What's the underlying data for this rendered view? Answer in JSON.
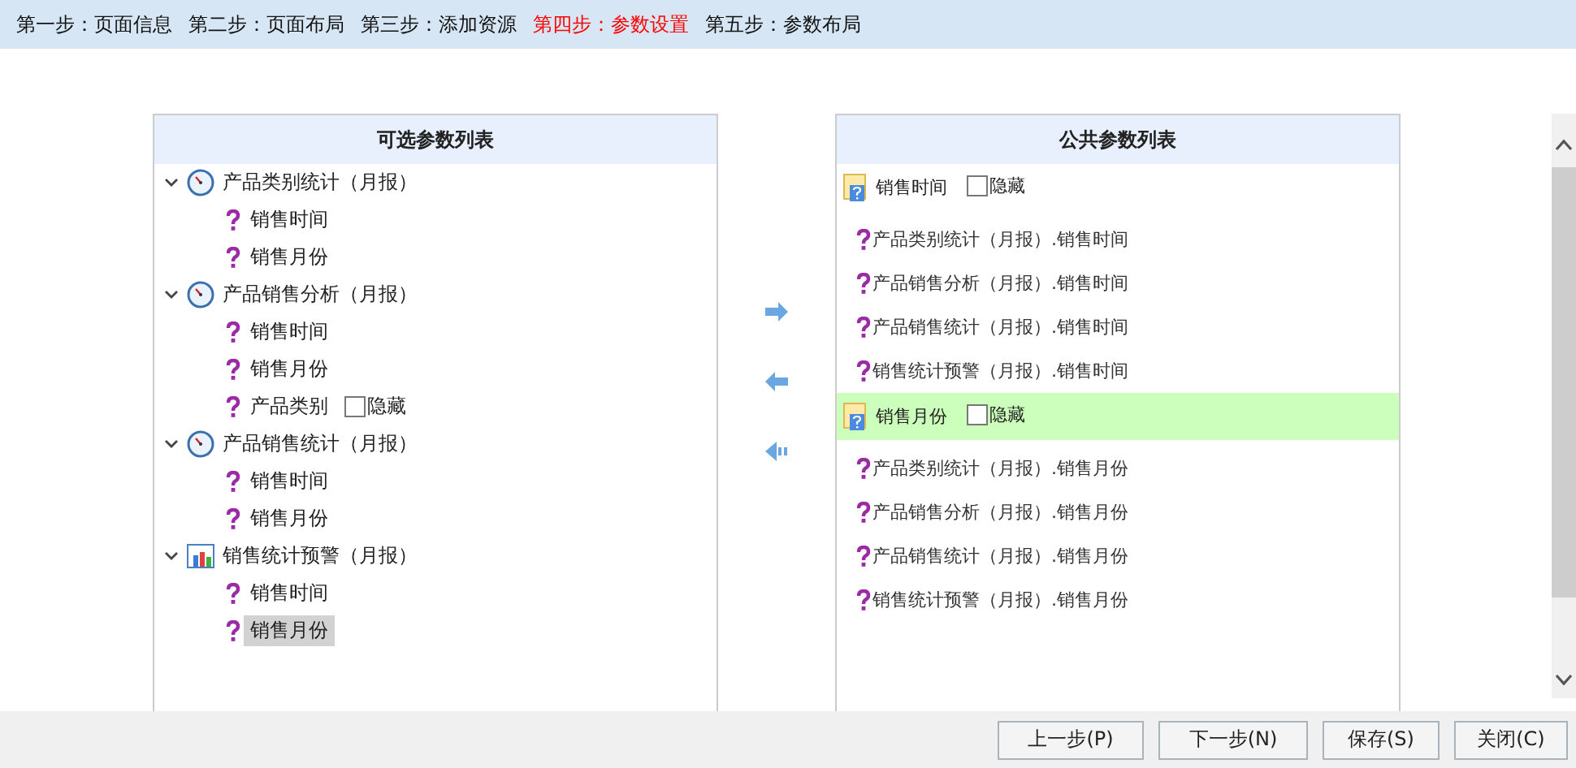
{
  "steps": [
    {
      "label": "第一步：页面信息",
      "selected": false
    },
    {
      "label": "第二步：页面布局",
      "selected": false
    },
    {
      "label": "第三步：添加资源",
      "selected": false
    },
    {
      "label": "第四步：参数设置",
      "selected": true
    },
    {
      "label": "第五步：参数布局",
      "selected": false
    }
  ],
  "available_panel": {
    "title": "可选参数列表",
    "groups": [
      {
        "label": "产品类别统计（月报）",
        "kind": "clock",
        "expanded": true,
        "children": [
          {
            "label": "销售时间",
            "selected": false
          },
          {
            "label": "销售月份",
            "selected": false
          }
        ]
      },
      {
        "label": "产品销售分析（月报）",
        "kind": "clock",
        "expanded": true,
        "children": [
          {
            "label": "销售时间",
            "selected": false
          },
          {
            "label": "销售月份",
            "selected": false
          },
          {
            "label": "产品类别",
            "selected": false,
            "hide_option": {
              "label": "隐藏",
              "checked": false
            }
          }
        ]
      },
      {
        "label": "产品销售统计（月报）",
        "kind": "clock",
        "expanded": true,
        "children": [
          {
            "label": "销售时间",
            "selected": false
          },
          {
            "label": "销售月份",
            "selected": false
          }
        ]
      },
      {
        "label": "销售统计预警（月报）",
        "kind": "chart",
        "expanded": true,
        "children": [
          {
            "label": "销售时间",
            "selected": false
          },
          {
            "label": "销售月份",
            "selected": true
          }
        ]
      }
    ]
  },
  "public_panel": {
    "title": "公共参数列表",
    "params": [
      {
        "label": "销售时间",
        "selected": false,
        "hide_option": {
          "label": "隐藏",
          "checked": false
        },
        "items": [
          "产品类别统计（月报）.销售时间",
          "产品销售分析（月报）.销售时间",
          "产品销售统计（月报）.销售时间",
          "销售统计预警（月报）.销售时间"
        ]
      },
      {
        "label": "销售月份",
        "selected": true,
        "hide_option": {
          "label": "隐藏",
          "checked": false
        },
        "items": [
          "产品类别统计（月报）.销售月份",
          "产品销售分析（月报）.销售月份",
          "产品销售统计（月报）.销售月份",
          "销售统计预警（月报）.销售月份"
        ]
      }
    ]
  },
  "buttons": [
    "上一步(P)",
    "下一步(N)",
    "保存(S)",
    "关闭(C)"
  ]
}
